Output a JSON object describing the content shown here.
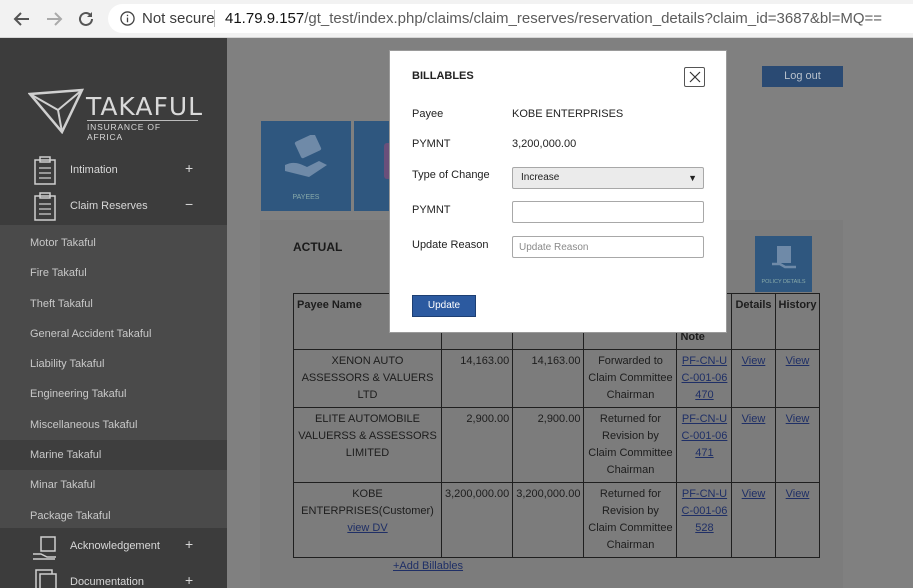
{
  "browser": {
    "not_secure": "Not secure",
    "url_host": "41.79.9.157",
    "url_path": "/gt_test/index.php/claims/claim_reserves/reservation_details?claim_id=3687&bl=MQ=="
  },
  "sidebar": {
    "logo_text": "TAKAFUL",
    "logo_sub": "INSURANCE OF AFRICA",
    "main_items": [
      {
        "label": "Intimation",
        "toggle": "+"
      },
      {
        "label": "Claim Reserves",
        "toggle": "−"
      },
      {
        "label": "Acknowledgement",
        "toggle": "+"
      },
      {
        "label": "Documentation",
        "toggle": "+"
      }
    ],
    "sub_items": [
      "Motor Takaful",
      "Fire Takaful",
      "Theft Takaful",
      "General Accident Takaful",
      "Liability Takaful",
      "Engineering Takaful",
      "Miscellaneous Takaful",
      "Marine Takaful",
      "Minar Takaful",
      "Package Takaful"
    ]
  },
  "header": {
    "logout": "Log out"
  },
  "tiles": {
    "payees": "PAYEES",
    "policy_details": "POLICY DETAILS"
  },
  "main": {
    "section_title": "ACTUAL",
    "table": {
      "headers": [
        "Payee Name",
        "",
        "",
        "",
        "Note",
        "Details",
        "History"
      ],
      "rows": [
        {
          "payee": "XENON AUTO ASSESSORS & VALUERS LTD",
          "payee_link": "",
          "amount1": "14,163.00",
          "amount2": "14,163.00",
          "status": "Forwarded to Claim Committee Chairman",
          "note": "PF-CN-UC-001-06470",
          "details": "View",
          "history": "View"
        },
        {
          "payee": "ELITE AUTOMOBILE VALUERSS & ASSESSORS LIMITED",
          "payee_link": "",
          "amount1": "2,900.00",
          "amount2": "2,900.00",
          "status": "Returned for Revision by Claim Committee Chairman",
          "note": "PF-CN-UC-001-06471",
          "details": "View",
          "history": "View"
        },
        {
          "payee": "KOBE ENTERPRISES(Customer)",
          "payee_link": "view DV",
          "amount1": "3,200,000.00",
          "amount2": "3,200,000.00",
          "status": "Returned for Revision by Claim Committee Chairman",
          "note": "PF-CN-UC-001-06528",
          "details": "View",
          "history": "View"
        }
      ]
    },
    "add_billables": "+Add Billables"
  },
  "modal": {
    "title": "BILLABLES",
    "payee_label": "Payee",
    "payee_value": "KOBE ENTERPRISES",
    "pymnt_label": "PYMNT",
    "pymnt_value": "3,200,000.00",
    "type_label": "Type of Change",
    "type_value": "Increase",
    "pymnt_input_label": "PYMNT",
    "pymnt_input_value": "",
    "reason_label": "Update Reason",
    "reason_placeholder": "Update Reason",
    "update_button": "Update"
  }
}
